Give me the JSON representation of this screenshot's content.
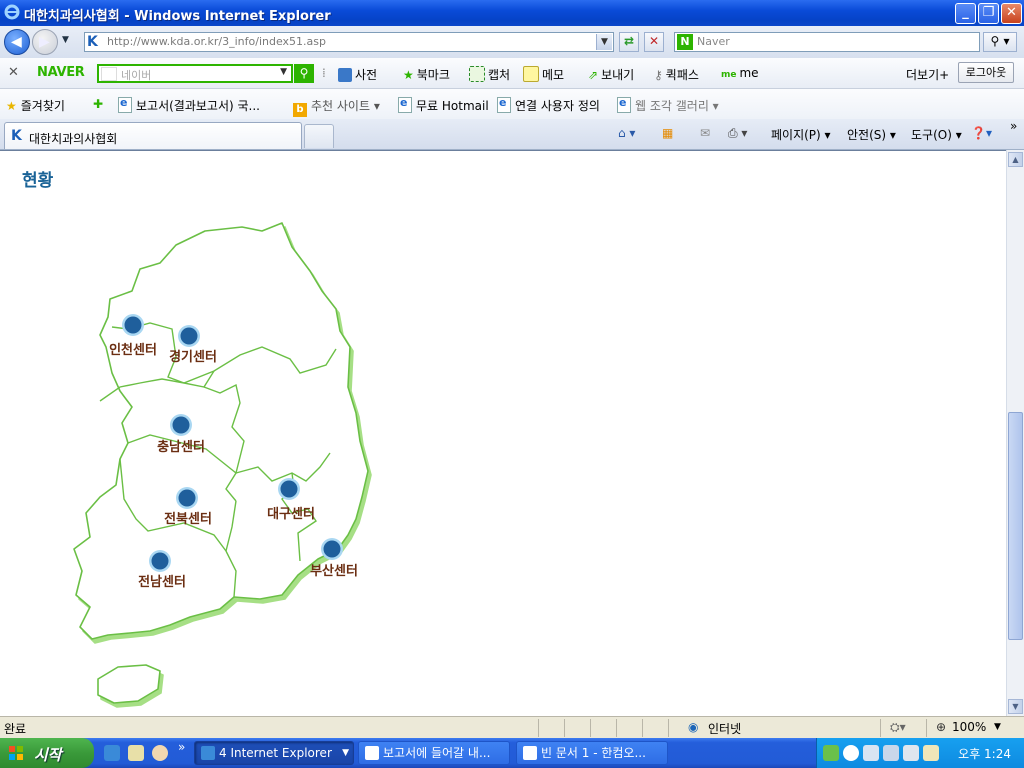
{
  "window": {
    "title": "대한치과의사협회 - Windows Internet Explorer"
  },
  "address_bar": {
    "url": "http://www.kda.or.kr/3_info/index51.asp",
    "search_placeholder": "Naver"
  },
  "naver_toolbar": {
    "logo": "NAVER",
    "search_placeholder": "네이버",
    "items": {
      "dict": "사전",
      "bookmark": "북마크",
      "capture": "캡처",
      "memo": "메모",
      "send": "보내기",
      "quickpass": "퀵패스",
      "me": "me",
      "more": "더보기+",
      "logout": "로그아웃"
    }
  },
  "favorites_bar": {
    "favorites": "즐겨찾기",
    "items": [
      "보고서(결과보고서) 국...",
      "추천 사이트 ▾",
      "무료 Hotmail",
      "연결 사용자 정의",
      "웹 조각 갤러리 ▾"
    ]
  },
  "tab": {
    "title": "대한치과의사협회"
  },
  "command_bar": {
    "page": "페이지(P) ▾",
    "safety": "안전(S) ▾",
    "tools": "도구(O) ▾"
  },
  "content": {
    "heading": "현황",
    "centers": [
      {
        "name": "인천센터"
      },
      {
        "name": "경기센터"
      },
      {
        "name": "충남센터"
      },
      {
        "name": "전북센터"
      },
      {
        "name": "대구센터"
      },
      {
        "name": "전남센터"
      },
      {
        "name": "부산센터"
      }
    ],
    "colors": {
      "map_outline": "#8cd06a",
      "dot": "#1f5f9c",
      "label": "#6b2e12",
      "heading": "#1a6397"
    }
  },
  "status_bar": {
    "status": "완료",
    "zone": "인터넷",
    "zoom": "100%"
  },
  "taskbar": {
    "start": "시작",
    "tasks": [
      "4 Internet Explorer",
      "보고서에 들어갈 내...",
      "빈 문서 1 - 한컴오..."
    ],
    "clock": "오후 1:24"
  }
}
